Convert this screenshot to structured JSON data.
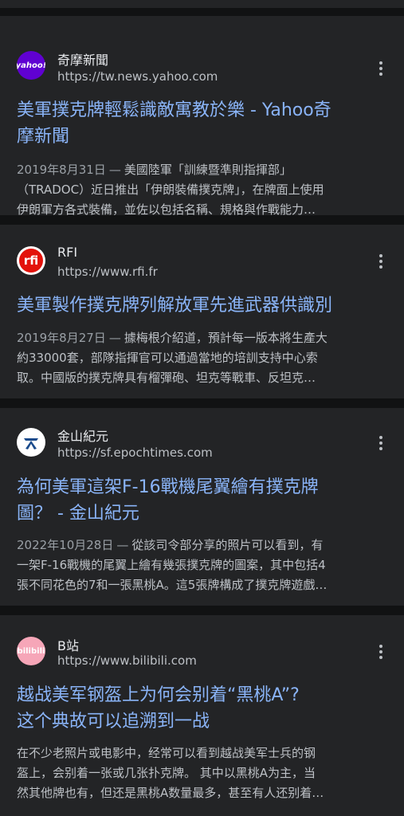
{
  "results": [
    {
      "logo_icon": "yahoo-logo-icon",
      "logo_text": "yahoo!",
      "source": "奇摩新聞",
      "url": "https://tw.news.yahoo.com",
      "title_lines": [
        "美軍撲克牌輕鬆識敵寓教於樂 - Yahoo奇",
        "摩新聞"
      ],
      "date": "2019年8月31日",
      "snippet_lines": [
        "美國陸軍「訓練暨準則指揮部」",
        "（TRADOC）近日推出「伊朗裝備撲克牌」，在牌面上使用",
        "伊朗軍方各式裝備，並佐以包括名稱、規格與作戰能力…"
      ]
    },
    {
      "logo_icon": "rfi-logo-icon",
      "logo_text": "rfi",
      "source": "RFI",
      "url": "https://www.rfi.fr",
      "title_lines": [
        "美軍製作撲克牌列解放軍先進武器供識別"
      ],
      "date": "2019年8月27日",
      "snippet_lines": [
        "據梅根介紹道，預計每一版本將生產大",
        "約33000套，部隊指揮官可以通過當地的培訓支持中心索",
        "取。中國版的撲克牌具有榴彈砲、坦克等戰車、反坦克…"
      ]
    },
    {
      "logo_icon": "epochtimes-logo-icon",
      "logo_text": "",
      "source": "金山紀元",
      "url": "https://sf.epochtimes.com",
      "title_lines": [
        "為何美軍這架F-16戰機尾翼繪有撲克牌",
        "圖？ - 金山紀元"
      ],
      "date": "2022年10月28日",
      "snippet_lines": [
        "從該司令部分享的照片可以看到，有",
        "一架F-16戰機的尾翼上繪有幾張撲克牌的圖案，其中包括4",
        "張不同花色的7和一張黑桃A。這5張牌構成了撲克牌遊戲…"
      ]
    },
    {
      "logo_icon": "bilibili-logo-icon",
      "logo_text": "bilibili",
      "source": "B站",
      "url": "https://www.bilibili.com",
      "title_lines": [
        "越战美军钢盔上为何会别着“黑桃A”?",
        "这个典故可以追溯到一战"
      ],
      "date": "",
      "snippet_lines": [
        "在不少老照片或电影中，经常可以看到越战美军士兵的钢",
        "盔上，会别着一张或几张扑克牌。 其中以黑桃A为主，当",
        "然其他牌也有，但还是黑桃A数量最多，甚至有人还别着…"
      ]
    }
  ],
  "colors": {
    "background": "#111213",
    "card": "#232426",
    "title_link": "#8ab4f8",
    "snippet_text": "#bdc1c6",
    "source_name": "#e8eaed"
  },
  "menu_icon": "more-vert-icon"
}
